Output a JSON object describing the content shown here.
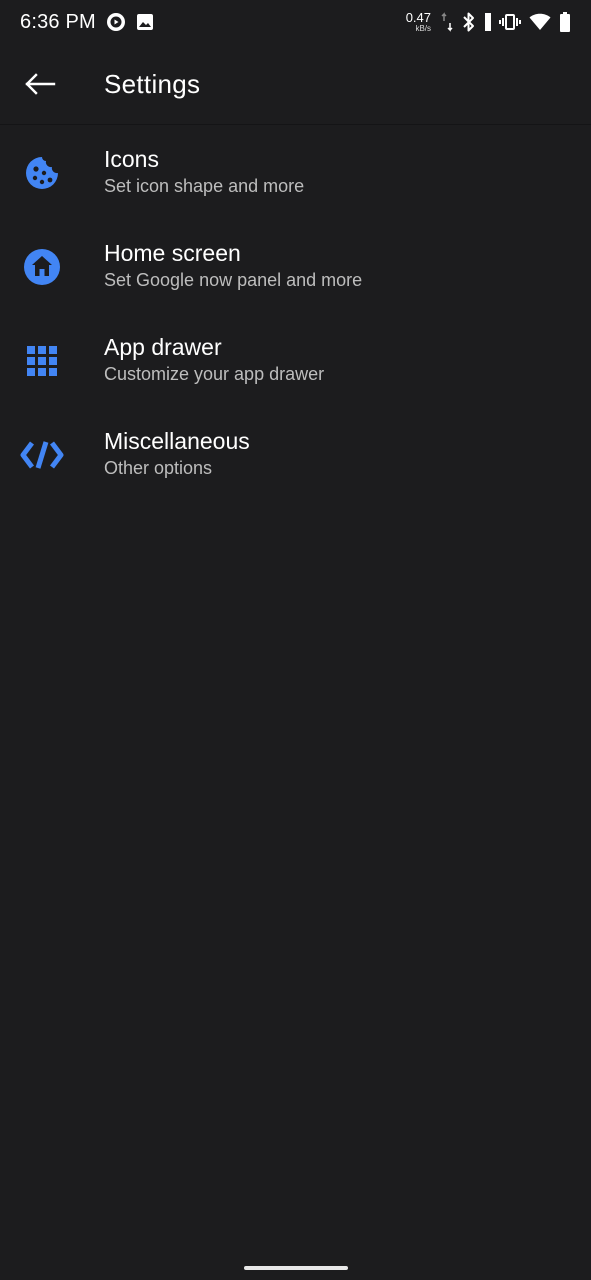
{
  "status_bar": {
    "time": "6:36 PM",
    "net_speed_value": "0.47",
    "net_speed_unit": "kB/s"
  },
  "app_bar": {
    "title": "Settings"
  },
  "settings_items": [
    {
      "title": "Icons",
      "subtitle": "Set icon shape and more",
      "icon": "cookie-icon"
    },
    {
      "title": "Home screen",
      "subtitle": "Set Google now panel and more",
      "icon": "home-icon"
    },
    {
      "title": "App drawer",
      "subtitle": "Customize your app drawer",
      "icon": "apps-grid-icon"
    },
    {
      "title": "Miscellaneous",
      "subtitle": "Other options",
      "icon": "code-icon"
    }
  ],
  "colors": {
    "background": "#1c1c1e",
    "accent": "#4285f4",
    "text_primary": "#ffffff",
    "text_secondary": "#bdbdbd"
  }
}
